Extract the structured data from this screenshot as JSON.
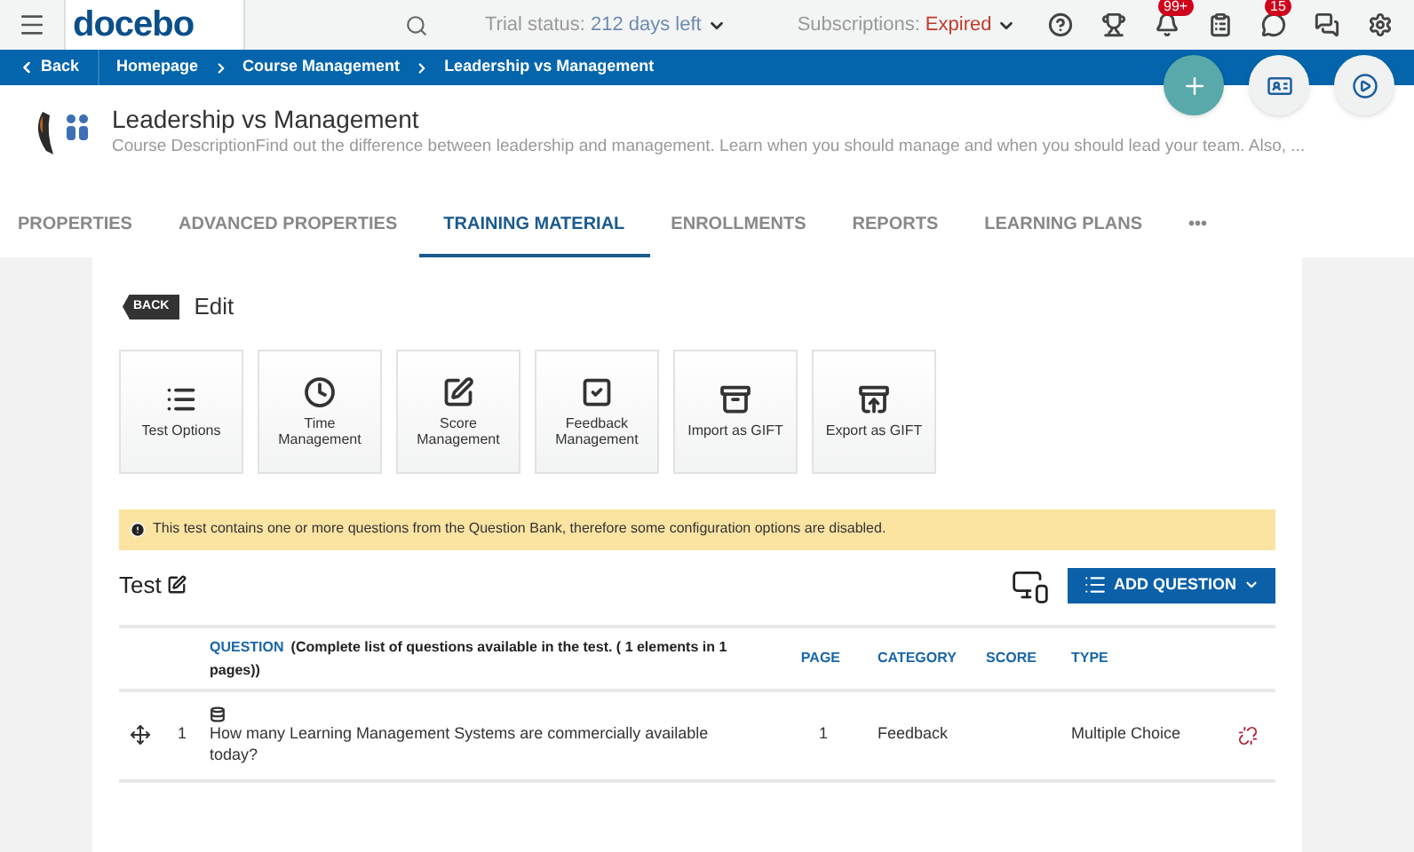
{
  "topbar": {
    "logo": "docebo",
    "trial_label": "Trial status:",
    "trial_value": "212 days left",
    "subs_label": "Subscriptions:",
    "subs_value": "Expired",
    "badges": [
      {
        "kind": "help"
      },
      {
        "kind": "trophy"
      },
      {
        "kind": "bell",
        "count": "99+"
      },
      {
        "kind": "clipboard"
      },
      {
        "kind": "chat",
        "count": "15"
      },
      {
        "kind": "messages"
      },
      {
        "kind": "settings"
      }
    ]
  },
  "breadcrumb": {
    "back": "Back",
    "items": [
      "Homepage",
      "Course Management",
      "Leadership vs Management"
    ]
  },
  "course": {
    "title": "Leadership vs Management",
    "description": "Course DescriptionFind out the difference between leadership and management. Learn when you should manage and when you should lead your team. Also, ..."
  },
  "tabs": [
    {
      "label": "PROPERTIES",
      "selected": false
    },
    {
      "label": "ADVANCED PROPERTIES",
      "selected": false
    },
    {
      "label": "TRAINING MATERIAL",
      "selected": true
    },
    {
      "label": "ENROLLMENTS",
      "selected": false
    },
    {
      "label": "REPORTS",
      "selected": false
    },
    {
      "label": "LEARNING PLANS",
      "selected": false
    },
    {
      "label": "•••",
      "selected": false
    }
  ],
  "edit": {
    "back": "BACK",
    "title": "Edit"
  },
  "tiles": [
    {
      "kind": "list",
      "label": "Test Options"
    },
    {
      "kind": "clock",
      "label": "Time Management"
    },
    {
      "kind": "pen",
      "label": "Score Management"
    },
    {
      "kind": "check",
      "label": "Feedback Management"
    },
    {
      "kind": "import",
      "label": "Import as GIFT"
    },
    {
      "kind": "export",
      "label": "Export as GIFT"
    }
  ],
  "alert": "This test contains one or more questions from the Question Bank, therefore some configuration options are disabled.",
  "test": {
    "title": "Test",
    "add_button": "ADD QUESTION"
  },
  "table": {
    "columns": [
      "QUESTION",
      "PAGE",
      "CATEGORY",
      "SCORE",
      "TYPE"
    ],
    "question_note": "(Complete list of questions available in the test. ( 1 elements in 1 pages))",
    "rows": [
      {
        "number": "1",
        "question": "How many Learning Management Systems are commercially available today?",
        "page": "1",
        "category": "Feedback",
        "score": "",
        "type": "Multiple Choice"
      }
    ]
  }
}
